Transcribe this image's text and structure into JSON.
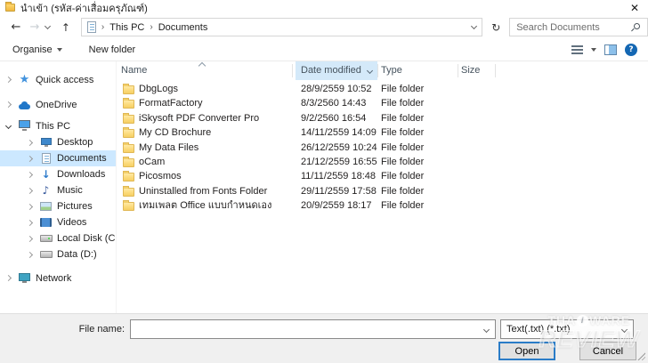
{
  "window": {
    "title": "นำเข้า (รหัส-ค่าเสื่อมครุภัณฑ์)"
  },
  "icons": {
    "close": "✕",
    "back": "←",
    "forward": "→",
    "up": "↑",
    "refresh": "↻",
    "star": "★",
    "downloads": "↓",
    "music": "♪",
    "help": "?"
  },
  "navbar": {
    "separator": "›",
    "breadcrumb_items": [
      "This PC",
      "Documents"
    ],
    "search_placeholder": "Search Documents"
  },
  "toolbar": {
    "organise": "Organise",
    "new_folder": "New folder"
  },
  "sidebar": {
    "items": [
      {
        "label": "Quick access"
      },
      {
        "label": "OneDrive"
      },
      {
        "label": "This PC"
      },
      {
        "label": "Desktop"
      },
      {
        "label": "Documents"
      },
      {
        "label": "Downloads"
      },
      {
        "label": "Music"
      },
      {
        "label": "Pictures"
      },
      {
        "label": "Videos"
      },
      {
        "label": "Local Disk (C:)"
      },
      {
        "label": "Data (D:)"
      },
      {
        "label": "Network"
      }
    ]
  },
  "file_list": {
    "columns": {
      "name": "Name",
      "date": "Date modified",
      "type": "Type",
      "size": "Size"
    },
    "rows": [
      {
        "name": "DbgLogs",
        "date": "28/9/2559 10:52",
        "type": "File folder",
        "size": ""
      },
      {
        "name": "FormatFactory",
        "date": "8/3/2560 14:43",
        "type": "File folder",
        "size": ""
      },
      {
        "name": "iSkysoft PDF Converter Pro",
        "date": "9/2/2560 16:54",
        "type": "File folder",
        "size": ""
      },
      {
        "name": "My CD Brochure",
        "date": "14/11/2559 14:09",
        "type": "File folder",
        "size": ""
      },
      {
        "name": "My Data Files",
        "date": "26/12/2559 10:24",
        "type": "File folder",
        "size": ""
      },
      {
        "name": "oCam",
        "date": "21/12/2559 16:55",
        "type": "File folder",
        "size": ""
      },
      {
        "name": "Picosmos",
        "date": "11/11/2559 18:48",
        "type": "File folder",
        "size": ""
      },
      {
        "name": "Uninstalled from Fonts Folder",
        "date": "29/11/2559 17:58",
        "type": "File folder",
        "size": ""
      },
      {
        "name": "เทมเพลต Office แบบกำหนดเอง",
        "date": "20/9/2559 18:17",
        "type": "File folder",
        "size": ""
      }
    ]
  },
  "footer": {
    "file_name_label": "File name:",
    "file_name_value": "",
    "file_type": "Text(.txt) (*.txt)",
    "open": "Open",
    "cancel": "Cancel"
  },
  "watermark": {
    "part1": "THA",
    "circle": "i",
    "part2": "WARE",
    "line2": "REVIEW"
  },
  "colors": {
    "accent": "#0078d7",
    "selection": "#cce8ff",
    "header_filter_bg": "#d4e9f9",
    "footer_bg": "#f0f0f0",
    "folder_yellow": "#fbd978"
  }
}
